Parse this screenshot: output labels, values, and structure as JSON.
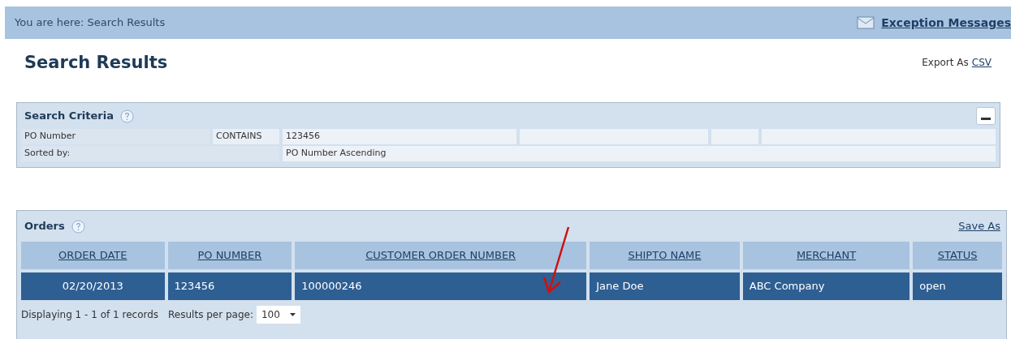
{
  "breadcrumb": "You are here: Search Results",
  "exception_link": "Exception Messages",
  "title": "Search Results",
  "export": {
    "label": "Export As",
    "link": "CSV"
  },
  "criteria": {
    "title": "Search Criteria",
    "rows": [
      {
        "field": "PO Number",
        "operator": "CONTAINS",
        "value": "123456"
      },
      {
        "field": "Sorted by:",
        "value": "PO Number Ascending"
      }
    ]
  },
  "orders": {
    "title": "Orders",
    "save_as": "Save As",
    "columns": [
      "ORDER DATE",
      "PO NUMBER",
      "CUSTOMER ORDER NUMBER",
      "SHIPTO NAME",
      "MERCHANT",
      "STATUS"
    ],
    "rows": [
      {
        "selected": true,
        "cells": [
          "02/20/2013",
          "123456",
          "100000246",
          "Jane Doe",
          "ABC Company",
          "open"
        ]
      }
    ],
    "footer": "Displaying 1 - 1 of 1 records",
    "per_page_label": "Results per page:",
    "per_page": "100"
  }
}
